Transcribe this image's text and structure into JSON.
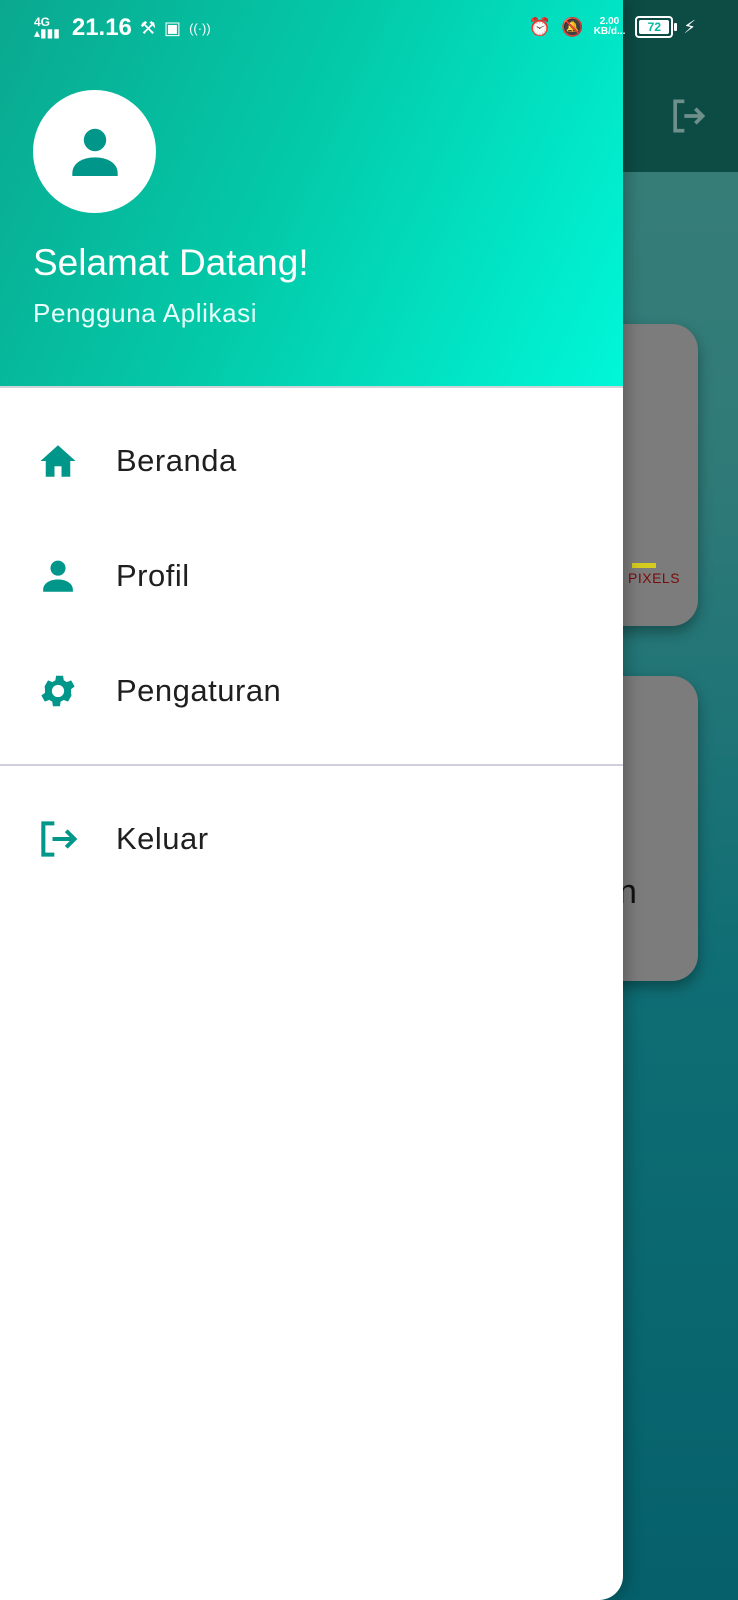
{
  "status_bar": {
    "network": "4G",
    "time": "21.16",
    "speed_value": "2.00",
    "speed_unit": "KB/d...",
    "battery": "72"
  },
  "background": {
    "pixels_label": "PIXELS",
    "card_partial_letter": "n"
  },
  "drawer": {
    "header": {
      "title": "Selamat Datang!",
      "subtitle": "Pengguna Aplikasi"
    },
    "items": [
      {
        "label": "Beranda",
        "icon": "home-icon"
      },
      {
        "label": "Profil",
        "icon": "person-icon"
      },
      {
        "label": "Pengaturan",
        "icon": "gear-icon"
      },
      {
        "label": "Keluar",
        "icon": "logout-icon"
      }
    ]
  },
  "colors": {
    "accent": "#00968a",
    "header_gradient_start": "#0aa88f",
    "header_gradient_end": "#00f7d8"
  }
}
